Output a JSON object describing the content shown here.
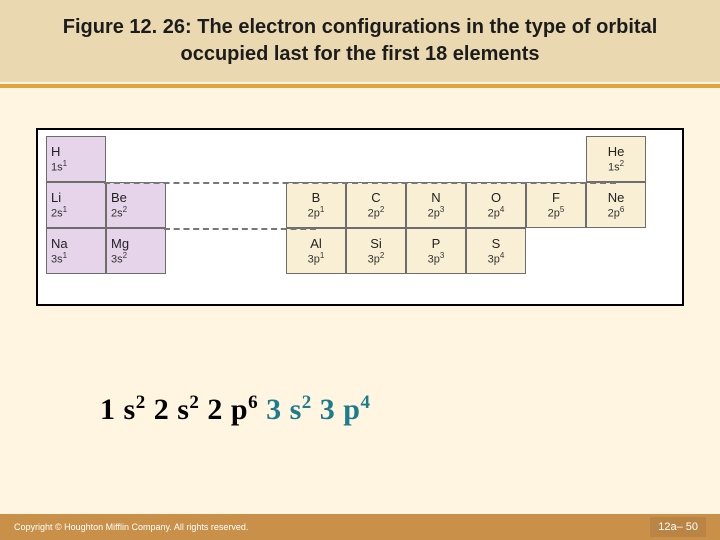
{
  "title": "Figure 12. 26:  The electron configurations in the type of orbital occupied last for the first 18 elements",
  "rows": [
    [
      {
        "sym": "H",
        "cfg_base": "1s",
        "cfg_sup": "1",
        "cls": "s-block"
      },
      null,
      null,
      null,
      null,
      null,
      null,
      null,
      null,
      {
        "sym": "He",
        "cfg_base": "1s",
        "cfg_sup": "2",
        "cls": "p-block",
        "center": true
      }
    ],
    [
      {
        "sym": "Li",
        "cfg_base": "2s",
        "cfg_sup": "1",
        "cls": "s-block"
      },
      {
        "sym": "Be",
        "cfg_base": "2s",
        "cfg_sup": "2",
        "cls": "s-block"
      },
      null,
      null,
      {
        "sym": "B",
        "cfg_base": "2p",
        "cfg_sup": "1",
        "cls": "p-block",
        "center": true
      },
      {
        "sym": "C",
        "cfg_base": "2p",
        "cfg_sup": "2",
        "cls": "p-block",
        "center": true
      },
      {
        "sym": "N",
        "cfg_base": "2p",
        "cfg_sup": "3",
        "cls": "p-block",
        "center": true
      },
      {
        "sym": "O",
        "cfg_base": "2p",
        "cfg_sup": "4",
        "cls": "p-block",
        "center": true
      },
      {
        "sym": "F",
        "cfg_base": "2p",
        "cfg_sup": "5",
        "cls": "p-block",
        "center": true
      },
      {
        "sym": "Ne",
        "cfg_base": "2p",
        "cfg_sup": "6",
        "cls": "p-block",
        "center": true
      }
    ],
    [
      {
        "sym": "Na",
        "cfg_base": "3s",
        "cfg_sup": "1",
        "cls": "s-block"
      },
      {
        "sym": "Mg",
        "cfg_base": "3s",
        "cfg_sup": "2",
        "cls": "s-block"
      },
      null,
      null,
      {
        "sym": "Al",
        "cfg_base": "3p",
        "cfg_sup": "1",
        "cls": "p-block",
        "center": true
      },
      {
        "sym": "Si",
        "cfg_base": "3p",
        "cfg_sup": "2",
        "cls": "p-block",
        "center": true
      },
      {
        "sym": "P",
        "cfg_base": "3p",
        "cfg_sup": "3",
        "cls": "p-block",
        "center": true
      },
      {
        "sym": "S",
        "cfg_base": "3p",
        "cfg_sup": "4",
        "cls": "p-block",
        "center": true
      },
      null,
      null
    ]
  ],
  "config_terms": [
    {
      "base": "1 s",
      "sup": "2",
      "teal": false
    },
    {
      "base": "2 s",
      "sup": "2",
      "teal": false
    },
    {
      "base": "2 p",
      "sup": "6",
      "teal": false
    },
    {
      "base": "3 s",
      "sup": "2",
      "teal": true
    },
    {
      "base": "3 p",
      "sup": "4",
      "teal": true
    }
  ],
  "footer": {
    "copyright": "Copyright © Houghton Mifflin Company. All rights reserved.",
    "page": "12a– 50"
  }
}
